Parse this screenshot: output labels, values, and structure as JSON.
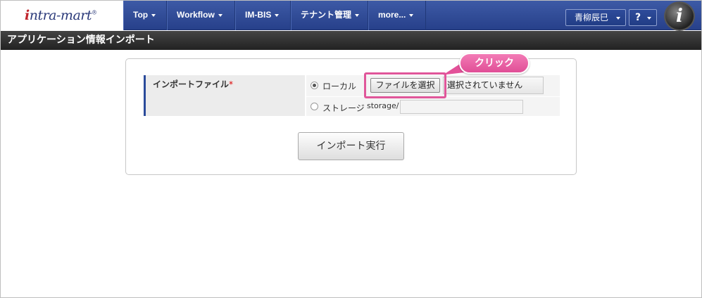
{
  "header": {
    "logo_text_i": "i",
    "logo_text_rest": "ntra-mart",
    "logo_reg": "®",
    "menus": [
      "Top",
      "Workflow",
      "IM-BIS",
      "テナント管理",
      "more..."
    ],
    "user_name": "青柳辰巳",
    "help_label": "?",
    "brand_mark": "i"
  },
  "page": {
    "title": "アプリケーション情報インポート"
  },
  "form": {
    "field_label": "インポートファイル",
    "required_mark": "*",
    "local_label": "ローカル",
    "file_button_label": "ファイルを選択",
    "file_status": "選択されていません",
    "storage_label": "ストレージ",
    "storage_prefix": "storage/",
    "storage_value": "",
    "local_selected": true,
    "import_button_label": "インポート実行"
  },
  "annotation": {
    "callout_label": "クリック",
    "highlight_color": "#e0569a"
  }
}
